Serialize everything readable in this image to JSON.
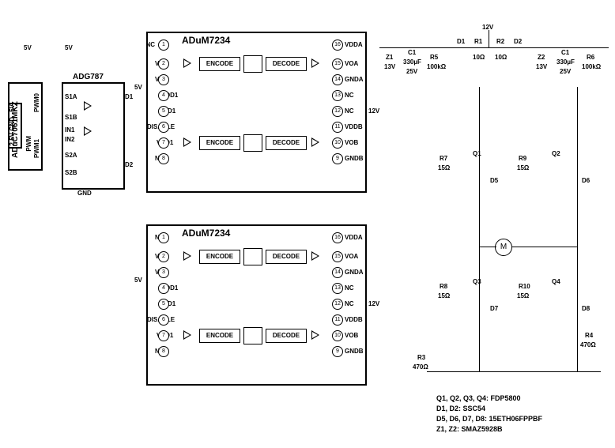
{
  "mcu": {
    "name": "ADuC7061MKZ",
    "rails": [
      "5V",
      "GND",
      "2.5V"
    ],
    "signals": [
      "PWM",
      "PWM0",
      "PWM1"
    ]
  },
  "switch": {
    "name": "ADG787",
    "ports": [
      "S1A",
      "S1B",
      "IN1",
      "IN2",
      "S2A",
      "S2B"
    ],
    "diodes": [
      "D1",
      "D2"
    ],
    "gnd": "GND",
    "v5a": "5V",
    "v5b": "5V"
  },
  "isolator1": {
    "name": "ADuM7234",
    "left_pins": [
      "NC",
      "VIA",
      "VIB",
      "VDD1",
      "GND1",
      "DISABLE",
      "VDD1",
      "NC"
    ],
    "right_pins": [
      "VDDA",
      "VOA",
      "GNDA",
      "NC",
      "NC",
      "VDDB",
      "VOB",
      "GNDB"
    ],
    "left_nums": [
      "1",
      "2",
      "3",
      "4",
      "5",
      "6",
      "7",
      "8"
    ],
    "right_nums": [
      "16",
      "15",
      "14",
      "13",
      "12",
      "11",
      "10",
      "9"
    ],
    "blocks": [
      "ENCODE",
      "DECODE",
      "ENCODE",
      "DECODE"
    ],
    "v5": "5V",
    "v12": "12V"
  },
  "isolator2": {
    "name": "ADuM7234",
    "left_pins": [
      "NC",
      "VIA",
      "VIB",
      "VDD1",
      "GND1",
      "DISABLE",
      "VDD1",
      "NC"
    ],
    "right_pins": [
      "VDDA",
      "VOA",
      "GNDA",
      "NC",
      "NC",
      "VDDB",
      "VOB",
      "GNDB"
    ],
    "left_nums": [
      "1",
      "2",
      "3",
      "4",
      "5",
      "6",
      "7",
      "8"
    ],
    "right_nums": [
      "16",
      "15",
      "14",
      "13",
      "12",
      "11",
      "10",
      "9"
    ],
    "blocks": [
      "ENCODE",
      "DECODE",
      "ENCODE",
      "DECODE"
    ],
    "v5": "5V",
    "v12": "12V"
  },
  "boot": {
    "v12": "12V",
    "d1": "D1",
    "r1": "R1",
    "r1v": "10Ω",
    "r2": "R2",
    "d2": "D2",
    "r2v": "10Ω",
    "z1": "Z1",
    "z1v": "13V",
    "c1": "C1",
    "c1v": "330µF",
    "c1r": "25V",
    "r5": "R5",
    "r5v": "100kΩ",
    "z2": "Z2",
    "z2v": "13V",
    "c2": "C1",
    "c2v": "330µF",
    "c2r": "25V",
    "r6": "R6",
    "r6v": "100kΩ"
  },
  "bridge": {
    "q1": "Q1",
    "q2": "Q2",
    "q3": "Q3",
    "q4": "Q4",
    "r7": "R7",
    "r7v": "15Ω",
    "r8": "R8",
    "r8v": "15Ω",
    "r9": "R9",
    "r9v": "15Ω",
    "r10": "R10",
    "r10v": "15Ω",
    "d5": "D5",
    "d6": "D6",
    "d7": "D7",
    "d8": "D8",
    "r3": "R3",
    "r3v": "470Ω",
    "r4": "R4",
    "r4v": "470Ω",
    "motor": "M"
  },
  "parts_note": {
    "l1": "Q1, Q2, Q3, Q4: FDP5800",
    "l2": "D1, D2: SSC54",
    "l3": "D5, D6, D7, D8: 15ETH06FPPBF",
    "l4": "Z1, Z2: SMAZ5928B"
  }
}
